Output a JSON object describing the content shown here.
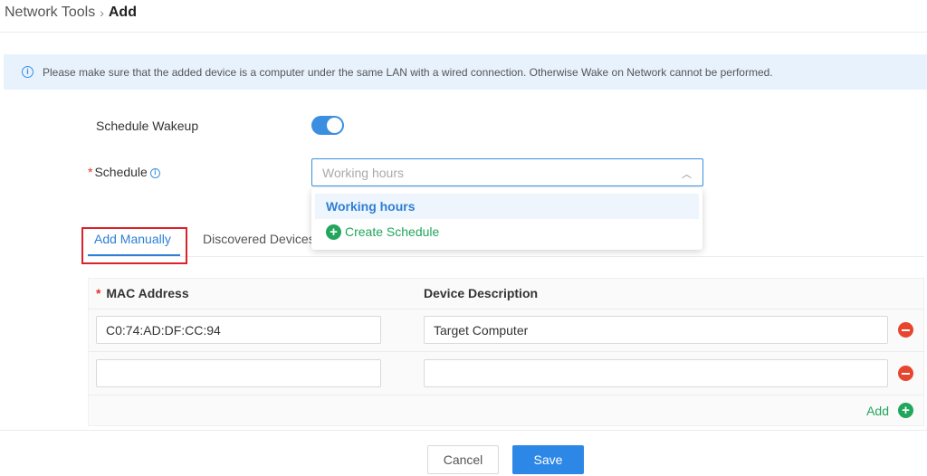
{
  "breadcrumb": {
    "parent": "Network Tools",
    "separator": "›",
    "current": "Add"
  },
  "notice": {
    "icon": "info-icon",
    "text": "Please make sure that the added device is a computer under the same LAN with a wired connection. Otherwise Wake on Network cannot be performed."
  },
  "form": {
    "schedule_wakeup_label": "Schedule Wakeup",
    "schedule_wakeup_enabled": true,
    "schedule_label": "Schedule",
    "required_mark": "*",
    "schedule_placeholder": "Working hours",
    "schedule_options": [
      "Working hours"
    ],
    "create_schedule_label": "Create Schedule"
  },
  "tabs": [
    {
      "label": "Add Manually",
      "active": true
    },
    {
      "label": "Discovered Devices",
      "active": false
    }
  ],
  "table": {
    "headers": {
      "mac": "MAC Address",
      "description": "Device Description"
    },
    "rows": [
      {
        "mac": "C0:74:AD:DF:CC:94",
        "description": "Target Computer"
      },
      {
        "mac": "",
        "description": ""
      }
    ],
    "add_label": "Add"
  },
  "buttons": {
    "cancel": "Cancel",
    "save": "Save"
  },
  "colors": {
    "accent": "#2d87e6",
    "success": "#21a65b",
    "danger": "#e8452e",
    "highlight": "#d9222a",
    "notice_bg": "#e8f2fd"
  }
}
